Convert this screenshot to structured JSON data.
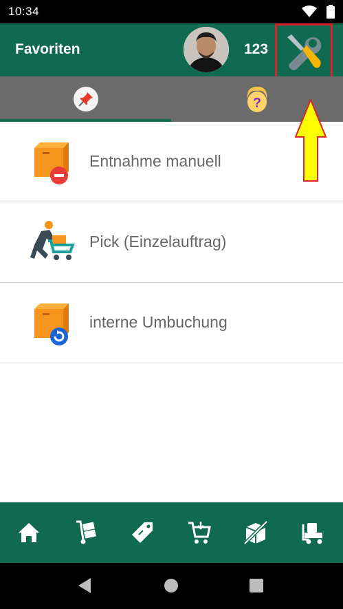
{
  "status_bar": {
    "time": "10:34",
    "icons": [
      "wifi-icon",
      "battery-icon"
    ]
  },
  "app_bar": {
    "title": "Favoriten",
    "user_number": "123",
    "avatar_icon": "avatar",
    "settings_icon": "wrench-screwdriver-icon"
  },
  "tabs": [
    {
      "icon": "pushpin-icon",
      "selected": true
    },
    {
      "icon": "help-person-icon",
      "selected": false
    }
  ],
  "list_items": [
    {
      "label": "Entnahme manuell",
      "icon": "box-minus-icon"
    },
    {
      "label": "Pick (Einzelauftrag)",
      "icon": "person-pushing-cart-icon"
    },
    {
      "label": "interne Umbuchung",
      "icon": "box-refresh-icon"
    }
  ],
  "bottom_nav": [
    {
      "icon": "home-icon"
    },
    {
      "icon": "hand-truck-icon"
    },
    {
      "icon": "tag-icon"
    },
    {
      "icon": "shopping-cart-icon"
    },
    {
      "icon": "box-crossed-icon"
    },
    {
      "icon": "forklift-icon"
    }
  ],
  "colors": {
    "primary": "#0f6a4f",
    "tab_bar": "#6b6b6b",
    "highlight": "#e0202a",
    "arrow": "#ffff00"
  }
}
